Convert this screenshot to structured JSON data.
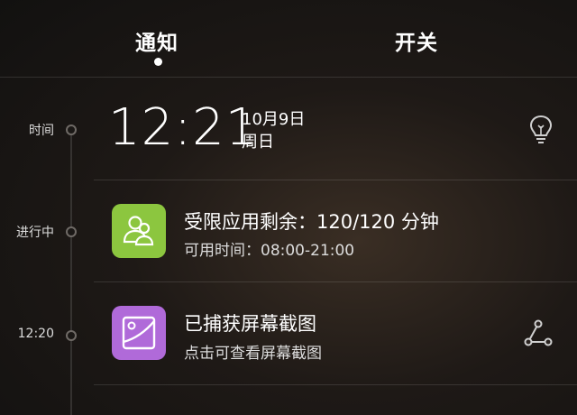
{
  "tabs": [
    {
      "label": "通知",
      "active": true
    },
    {
      "label": "开关",
      "active": false
    }
  ],
  "timeline": {
    "row1_label": "时间",
    "row2_label": "进行中",
    "row3_label": "12:20"
  },
  "clock": {
    "time": "12:21",
    "date": "10月9日",
    "weekday": "周日",
    "icon": "lightbulb-icon"
  },
  "notifications": [
    {
      "title": "受限应用剩余：120/120 分钟",
      "subtitle": "可用时间：08:00-21:00",
      "icon": "users-icon",
      "icon_color": "#8cc63f"
    },
    {
      "title": "已捕获屏幕截图",
      "subtitle": "点击可查看屏幕截图",
      "icon": "image-icon",
      "icon_color": "#b06ad9",
      "action_icon": "share-icon"
    }
  ]
}
